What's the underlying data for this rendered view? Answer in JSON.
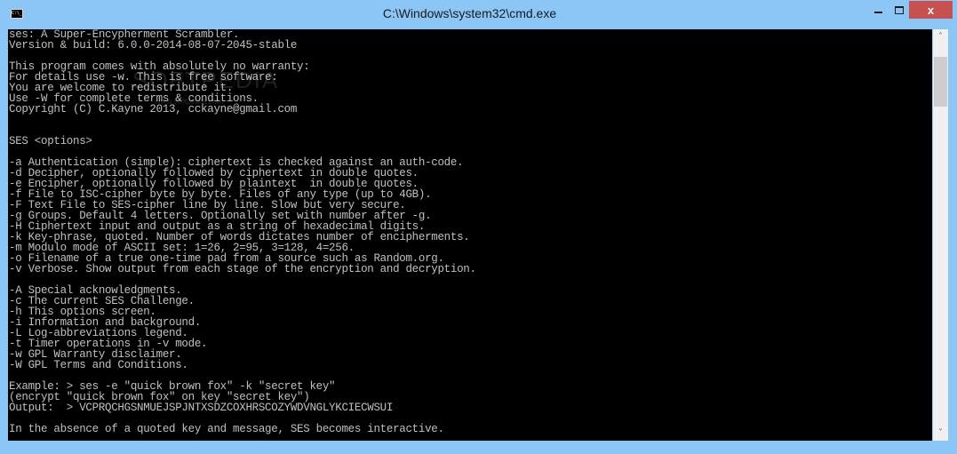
{
  "window": {
    "title": "C:\\Windows\\system32\\cmd.exe",
    "icon_label": "C:\\_",
    "controls": {
      "minimize": "minimize-icon",
      "maximize": "maximize-icon",
      "close_label": "x"
    }
  },
  "console": {
    "lines": [
      "ses: A Super-Encypherment Scrambler.",
      "Version & build: 6.0.0-2014-08-07-2045-stable",
      "",
      "This program comes with absolutely no warranty:",
      "For details use -w. This is free software:",
      "You are welcome to redistribute it.",
      "Use -W for complete terms & conditions.",
      "Copyright (C) C.Kayne 2013, cckayne@gmail.com",
      "",
      "",
      "SES <options>",
      "",
      "-a Authentication (simple): ciphertext is checked against an auth-code.",
      "-d Decipher, optionally followed by ciphertext in double quotes.",
      "-e Encipher, optionally followed by plaintext  in double quotes.",
      "-f File to ISC-cipher byte by byte. Files of any type (up to 4GB).",
      "-F Text File to SES-cipher line by line. Slow but very secure.",
      "-g Groups. Default 4 letters. Optionally set with number after -g.",
      "-H Ciphertext input and output as a string of hexadecimal digits.",
      "-k Key-phrase, quoted. Number of words dictates number of encipherments.",
      "-m Modulo mode of ASCII set: 1=26, 2=95, 3=128, 4=256.",
      "-o Filename of a true one-time pad from a source such as Random.org.",
      "-v Verbose. Show output from each stage of the encryption and decryption.",
      "",
      "-A Special acknowledgments.",
      "-c The current SES Challenge.",
      "-h This options screen.",
      "-i Information and background.",
      "-L Log-abbreviations legend.",
      "-t Timer operations in -v mode.",
      "-w GPL Warranty disclaimer.",
      "-W GPL Terms and Conditions.",
      "",
      "Example: > ses -e \"quick brown fox\" -k \"secret key\"",
      "(encrypt \"quick brown fox\" on key \"secret key\")",
      "Output:  > VCPRQCHGSNMUEJSPJNTXSDZCOXHRSCOZYWDVNGLYKCIECWSUI",
      "",
      "In the absence of a quoted key and message, SES becomes interactive."
    ]
  },
  "scrollbar": {
    "up_glyph": "˄",
    "down_glyph": "˅"
  },
  "watermark": {
    "text": "SOFTPEDIA",
    "url_text": "www.softpedia.com"
  },
  "colors": {
    "titlebar": "#8cc6f7",
    "close_button": "#c75050",
    "console_bg": "#000000",
    "console_fg": "#c0c0c0"
  }
}
